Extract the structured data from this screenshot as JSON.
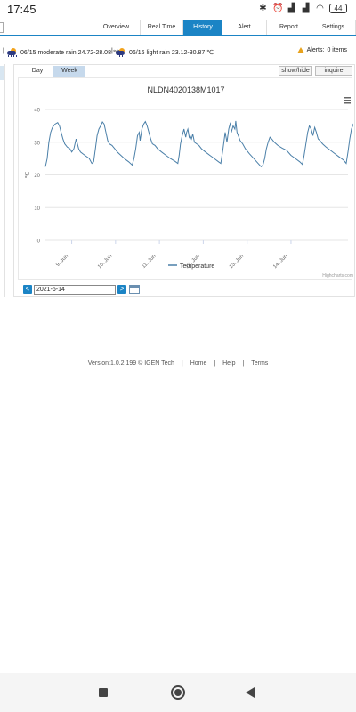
{
  "status_bar": {
    "time": "17:45",
    "battery": "44",
    "icons": [
      "bluetooth-icon",
      "alarm-icon",
      "signal-icon",
      "signal-icon",
      "wifi-icon",
      "battery-icon"
    ]
  },
  "nav": {
    "tabs": [
      {
        "label": "Overview",
        "active": false
      },
      {
        "label": "Real Time",
        "active": false
      },
      {
        "label": "History",
        "active": true
      },
      {
        "label": "Alert",
        "active": false
      },
      {
        "label": "Report",
        "active": false
      },
      {
        "label": "Settings",
        "active": false
      }
    ],
    "accent": "#1b84c5"
  },
  "weather": {
    "separator": "|",
    "forecasts": [
      {
        "text": "06/15 moderate rain 24.72-28.08 ℃",
        "icon": "rain-sun-icon"
      },
      {
        "text": "06/16 light rain 23.12-30.87 ℃",
        "icon": "rain-sun-icon"
      }
    ],
    "alerts_label": "Alerts:",
    "alerts_count": "0 items"
  },
  "panel": {
    "subtabs": [
      {
        "label": "Day",
        "active": false
      },
      {
        "label": "Week",
        "active": true
      }
    ],
    "show_hide_label": "show/hide",
    "inquire_label": "inquire",
    "date_value": "2021-6-14",
    "prev_label": "<",
    "next_label": ">"
  },
  "chart_data": {
    "type": "line",
    "title": "NLDN4020138M1017",
    "ylabel": "℃",
    "xlabel": "",
    "ylim": [
      0,
      40
    ],
    "yticks": [
      0,
      10,
      20,
      30,
      40
    ],
    "x_ticks": [
      "9. Jun",
      "10. Jun",
      "11. Jun",
      "12. Jun",
      "13. Jun",
      "14. Jun"
    ],
    "x_range_days": [
      8.4,
      15.3
    ],
    "grid": true,
    "legend_position": "bottom",
    "credits": "Highcharts.com",
    "series": [
      {
        "name": "Temperature",
        "color": "#4a7fa8",
        "points": [
          [
            8.4,
            22.5
          ],
          [
            8.44,
            25
          ],
          [
            8.48,
            30
          ],
          [
            8.52,
            33
          ],
          [
            8.56,
            34.5
          ],
          [
            8.62,
            35.5
          ],
          [
            8.68,
            36
          ],
          [
            8.72,
            35
          ],
          [
            8.76,
            33
          ],
          [
            8.8,
            31
          ],
          [
            8.84,
            29.5
          ],
          [
            8.9,
            28.5
          ],
          [
            8.96,
            28
          ],
          [
            9.0,
            27
          ],
          [
            9.05,
            28
          ],
          [
            9.1,
            31
          ],
          [
            9.12,
            30
          ],
          [
            9.16,
            28
          ],
          [
            9.2,
            27
          ],
          [
            9.3,
            26
          ],
          [
            9.4,
            25
          ],
          [
            9.46,
            23.5
          ],
          [
            9.5,
            24
          ],
          [
            9.54,
            28
          ],
          [
            9.58,
            32
          ],
          [
            9.62,
            34
          ],
          [
            9.66,
            35
          ],
          [
            9.7,
            36.2
          ],
          [
            9.74,
            35.5
          ],
          [
            9.78,
            33
          ],
          [
            9.82,
            30.5
          ],
          [
            9.86,
            29.5
          ],
          [
            9.92,
            29
          ],
          [
            9.98,
            28
          ],
          [
            10.04,
            27
          ],
          [
            10.12,
            26
          ],
          [
            10.2,
            25
          ],
          [
            10.3,
            24
          ],
          [
            10.38,
            23
          ],
          [
            10.42,
            25
          ],
          [
            10.46,
            28
          ],
          [
            10.5,
            32
          ],
          [
            10.54,
            33
          ],
          [
            10.56,
            30.5
          ],
          [
            10.6,
            34
          ],
          [
            10.64,
            35.5
          ],
          [
            10.68,
            36.3
          ],
          [
            10.72,
            35
          ],
          [
            10.76,
            33
          ],
          [
            10.8,
            31
          ],
          [
            10.84,
            29.5
          ],
          [
            10.9,
            29
          ],
          [
            10.96,
            28
          ],
          [
            11.05,
            27
          ],
          [
            11.15,
            26
          ],
          [
            11.25,
            25
          ],
          [
            11.35,
            24.2
          ],
          [
            11.42,
            23.5
          ],
          [
            11.45,
            26
          ],
          [
            11.48,
            29.5
          ],
          [
            11.52,
            32
          ],
          [
            11.56,
            34
          ],
          [
            11.6,
            31.5
          ],
          [
            11.62,
            33
          ],
          [
            11.65,
            34
          ],
          [
            11.68,
            31.5
          ],
          [
            11.7,
            32
          ],
          [
            11.73,
            31
          ],
          [
            11.76,
            32.5
          ],
          [
            11.8,
            30
          ],
          [
            11.85,
            29.5
          ],
          [
            11.9,
            29
          ],
          [
            11.96,
            28
          ],
          [
            12.05,
            27
          ],
          [
            12.15,
            26
          ],
          [
            12.25,
            25
          ],
          [
            12.35,
            24
          ],
          [
            12.4,
            23.5
          ],
          [
            12.45,
            28
          ],
          [
            12.5,
            33
          ],
          [
            12.54,
            30
          ],
          [
            12.58,
            34
          ],
          [
            12.62,
            36
          ],
          [
            12.64,
            33
          ],
          [
            12.68,
            35
          ],
          [
            12.72,
            34
          ],
          [
            12.74,
            36.5
          ],
          [
            12.77,
            33
          ],
          [
            12.8,
            32
          ],
          [
            12.84,
            30.5
          ],
          [
            12.9,
            29.5
          ],
          [
            12.96,
            28
          ],
          [
            13.05,
            26.5
          ],
          [
            13.15,
            25
          ],
          [
            13.25,
            23.5
          ],
          [
            13.32,
            22.5
          ],
          [
            13.36,
            23
          ],
          [
            13.4,
            25
          ],
          [
            13.44,
            28
          ],
          [
            13.48,
            30
          ],
          [
            13.52,
            31.5
          ],
          [
            13.56,
            31
          ],
          [
            13.62,
            30
          ],
          [
            13.7,
            29
          ],
          [
            13.8,
            28.2
          ],
          [
            13.9,
            27.5
          ],
          [
            14.0,
            26
          ],
          [
            14.1,
            25
          ],
          [
            14.2,
            24
          ],
          [
            14.26,
            23.2
          ],
          [
            14.3,
            26
          ],
          [
            14.34,
            29.5
          ],
          [
            14.38,
            33
          ],
          [
            14.42,
            35
          ],
          [
            14.46,
            34
          ],
          [
            14.5,
            32
          ],
          [
            14.54,
            34.5
          ],
          [
            14.58,
            33
          ],
          [
            14.62,
            31
          ],
          [
            14.66,
            30.5
          ],
          [
            14.72,
            29.5
          ],
          [
            14.8,
            28.5
          ],
          [
            14.9,
            27.5
          ],
          [
            15.0,
            26.5
          ],
          [
            15.1,
            25.5
          ],
          [
            15.2,
            24.5
          ],
          [
            15.26,
            23.5
          ],
          [
            15.3,
            27
          ],
          [
            15.34,
            31
          ],
          [
            15.38,
            34
          ],
          [
            15.42,
            35.5
          ],
          [
            15.46,
            36.2
          ],
          [
            15.5,
            35.5
          ],
          [
            15.54,
            33
          ],
          [
            15.58,
            31.5
          ],
          [
            15.62,
            32.5
          ],
          [
            15.66,
            30.5
          ],
          [
            15.7,
            29.5
          ]
        ]
      }
    ]
  },
  "footer": {
    "version": "Version:1.0.2.199 © IGEN Tech",
    "links": [
      "Home",
      "Help",
      "Terms"
    ],
    "separator": "|"
  }
}
